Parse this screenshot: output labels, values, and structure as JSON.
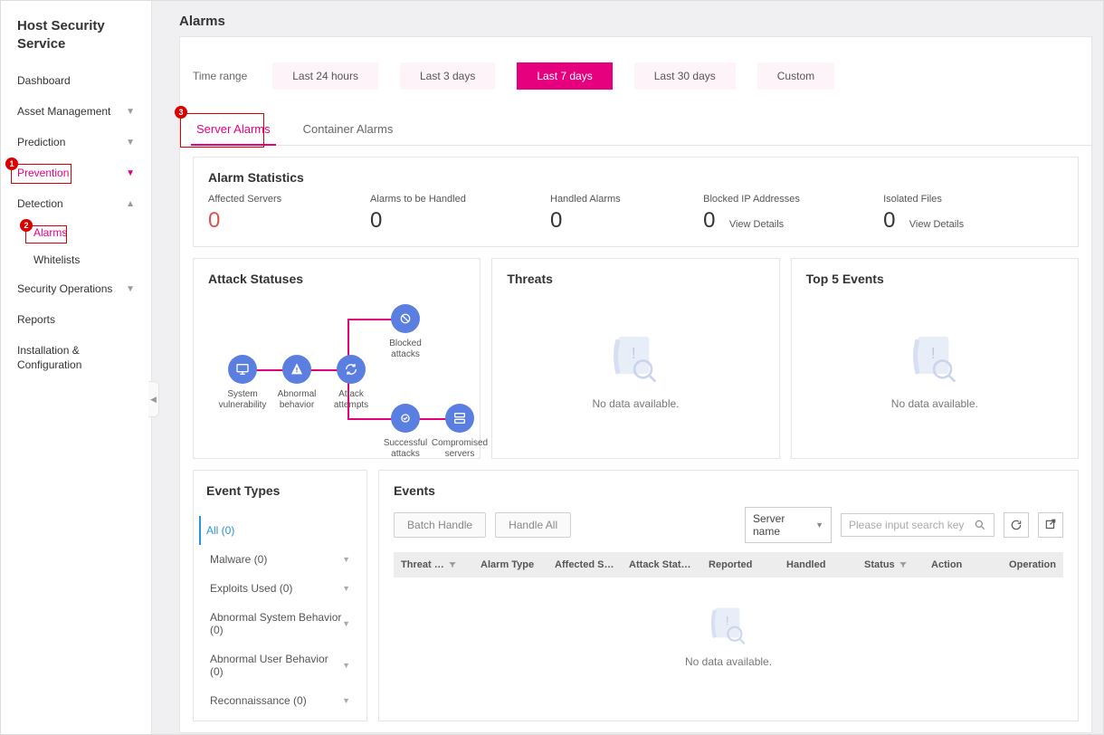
{
  "sidebar": {
    "title": "Host Security Service",
    "items": [
      {
        "label": "Dashboard"
      },
      {
        "label": "Asset Management",
        "chev": "▼"
      },
      {
        "label": "Prediction",
        "chev": "▼"
      },
      {
        "label": "Prevention",
        "chev": "▼",
        "pink": true
      },
      {
        "label": "Detection",
        "chev": "▲",
        "children": [
          {
            "label": "Alarms",
            "pink": true
          },
          {
            "label": "Whitelists"
          }
        ]
      },
      {
        "label": "Security Operations",
        "chev": "▼"
      },
      {
        "label": "Reports"
      },
      {
        "label": "Installation & Configuration"
      }
    ]
  },
  "page": {
    "title": "Alarms"
  },
  "timeRange": {
    "label": "Time range",
    "options": [
      "Last 24 hours",
      "Last 3 days",
      "Last 7 days",
      "Last 30 days",
      "Custom"
    ],
    "active": "Last 7 days"
  },
  "tabs": {
    "server": "Server Alarms",
    "container": "Container Alarms"
  },
  "alarmStats": {
    "title": "Alarm Statistics",
    "affected": {
      "label": "Affected Servers",
      "value": "0"
    },
    "toHandle": {
      "label": "Alarms to be Handled",
      "value": "0"
    },
    "handled": {
      "label": "Handled Alarms",
      "value": "0"
    },
    "blocked": {
      "label": "Blocked IP Addresses",
      "value": "0",
      "link": "View Details"
    },
    "isolated": {
      "label": "Isolated Files",
      "value": "0",
      "link": "View Details"
    }
  },
  "attack": {
    "title": "Attack Statuses",
    "nodes": {
      "sys": "System vulnerability",
      "ab": "Abnormal behavior",
      "att": "Attack attempts",
      "blocked": "Blocked attacks",
      "succ": "Successful attacks",
      "comp": "Compromised servers"
    }
  },
  "threats": {
    "title": "Threats",
    "empty": "No data available."
  },
  "topEvents": {
    "title": "Top 5 Events",
    "empty": "No data available."
  },
  "eventTypes": {
    "title": "Event Types",
    "all": "All (0)",
    "items": [
      "Malware (0)",
      "Exploits Used (0)",
      "Abnormal System Behavior (0)",
      "Abnormal User Behavior (0)",
      "Reconnaissance (0)"
    ]
  },
  "events": {
    "title": "Events",
    "batch": "Batch Handle",
    "handleAll": "Handle All",
    "selectLabel": "Server name",
    "searchPlaceholder": "Please input search key",
    "headers": [
      "Threat …",
      "Alarm Type",
      "Affected S…",
      "Attack Stat…",
      "Reported",
      "Handled",
      "Status",
      "Action",
      "Operation"
    ],
    "empty": "No data available."
  },
  "annotations": {
    "b1": "1",
    "b2": "2",
    "b3": "3"
  }
}
